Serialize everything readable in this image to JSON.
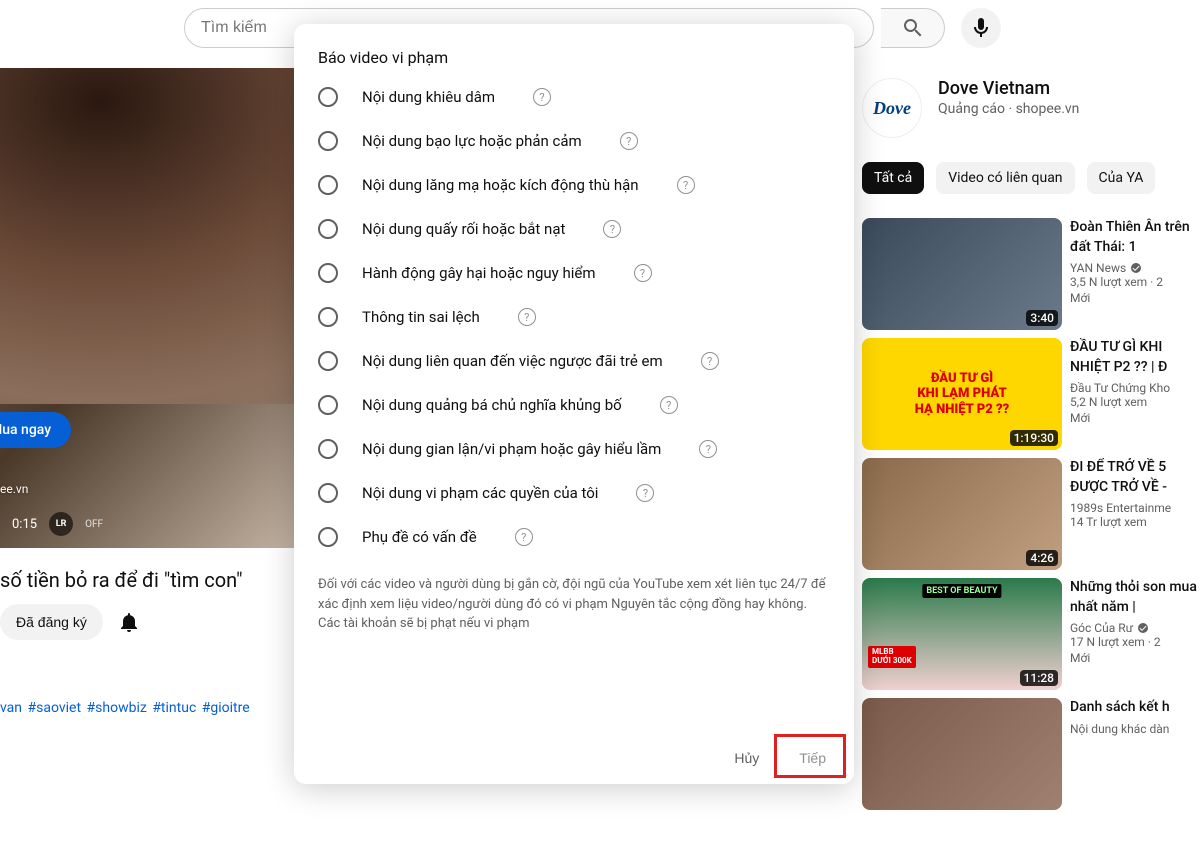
{
  "search": {
    "placeholder": "Tìm kiếm"
  },
  "video": {
    "time": "0:15",
    "off": "OFF",
    "buy_now": "Mua ngay",
    "sponsor": "ee.vn",
    "title": "số tiền bỏ ra để đi \"tìm con\"",
    "subscribed": "Đã đăng ký",
    "hashtags": [
      "van",
      "#saoviet",
      "#showbiz",
      "#tintuc",
      "#gioitre"
    ]
  },
  "ad": {
    "logo": "Dove",
    "title": "Dove Vietnam",
    "label": "Quảng cáo",
    "host": "shopee.vn"
  },
  "chips": [
    "Tất cả",
    "Video có liên quan",
    "Của YA"
  ],
  "recs": [
    {
      "title": "Đoàn Thiên Ân trên đất Thái: 1",
      "channel": "YAN News",
      "verified": true,
      "views": "3,5 N lượt xem",
      "ago": "2",
      "badge": "Mới",
      "dur": "3:40",
      "thumb_txt": ""
    },
    {
      "title": "ĐẦU TƯ GÌ KHI NHIỆT P2 ?? | Đ",
      "channel": "Đầu Tư Chứng Kho",
      "verified": false,
      "views": "5,2 N lượt xem",
      "ago": "",
      "badge": "Mới",
      "dur": "1:19:30",
      "thumb_txt": "ĐẦU TƯ GÌ\nKHI LẠM PHÁT\nHẠ NHIỆT P2 ??"
    },
    {
      "title": "ĐI ĐỂ TRỞ VỀ 5 ĐƯỢC TRỞ VỀ -",
      "channel": "1989s Entertainme",
      "verified": false,
      "views": "14 Tr lượt xem",
      "ago": "",
      "badge": "",
      "dur": "4:26",
      "thumb_txt": ""
    },
    {
      "title": "Những thỏi son mua nhất năm |",
      "channel": "Góc Của Rư",
      "verified": true,
      "views": "17 N lượt xem",
      "ago": "2",
      "badge": "Mới",
      "dur": "11:28",
      "thumb_txt": ""
    },
    {
      "title": "Danh sách kết h",
      "channel": "Nội dung khác dàn",
      "verified": false,
      "views": "",
      "ago": "",
      "badge": "",
      "dur": "",
      "thumb_txt": ""
    }
  ],
  "thumb_banner_4": "BEST OF BEAUTY",
  "thumb_badge_4": "MLBB\nDƯỚI 300K",
  "modal": {
    "title": "Báo video vi phạm",
    "options": [
      "Nội dung khiêu dâm",
      "Nội dung bạo lực hoặc phản cảm",
      "Nội dung lăng mạ hoặc kích động thù hận",
      "Nội dung quấy rối hoặc bắt nạt",
      "Hành động gây hại hoặc nguy hiểm",
      "Thông tin sai lệch",
      "Nội dung liên quan đến việc ngược đãi trẻ em",
      "Nội dung quảng bá chủ nghĩa khủng bố",
      "Nội dung gian lận/vi phạm hoặc gây hiểu lầm",
      "Nội dung vi phạm các quyền của tôi",
      "Phụ đề có vấn đề"
    ],
    "footer": "Đối với các video và người dùng bị gắn cờ, đội ngũ của YouTube xem xét liên tục 24/7 để xác định xem liệu video/người dùng đó có vi phạm Nguyên tắc cộng đồng hay không. Các tài khoản sẽ bị phạt nếu vi phạm",
    "cancel": "Hủy",
    "next": "Tiếp"
  }
}
